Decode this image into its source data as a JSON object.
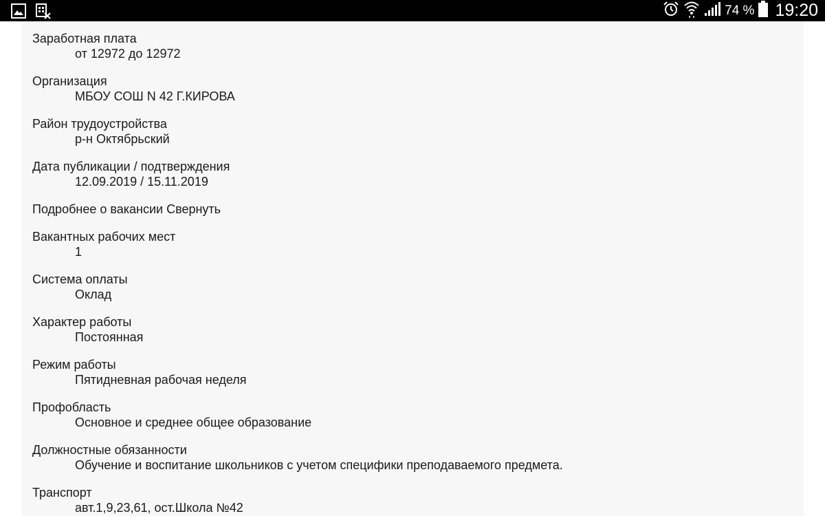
{
  "status_bar": {
    "left_icons": [
      "gallery-icon",
      "sim-toolkit-icon"
    ],
    "right_icons": [
      "alarm-icon",
      "wifi-icon",
      "signal-icon",
      "battery-icon"
    ],
    "battery": "74 %",
    "time": "19:20"
  },
  "vacancy": {
    "salary": {
      "label": "Заработная плата",
      "value": "от 12972 до 12972"
    },
    "organization": {
      "label": "Организация",
      "value": "МБОУ СОШ N 42 Г.КИРОВА"
    },
    "district": {
      "label": "Район трудоустройства",
      "value": "р-н Октябрьский"
    },
    "dates": {
      "label": "Дата публикации / подтверждения",
      "value": "12.09.2019 / 15.11.2019"
    },
    "details_toggle": {
      "label": "Подробнее о вакансии",
      "action": "Свернуть"
    },
    "vacant_places": {
      "label": "Вакантных рабочих мест",
      "value": "1"
    },
    "payment_system": {
      "label": "Система оплаты",
      "value": "Оклад"
    },
    "work_nature": {
      "label": "Характер работы",
      "value": "Постоянная"
    },
    "work_mode": {
      "label": "Режим работы",
      "value": "Пятидневная рабочая неделя"
    },
    "professional_area": {
      "label": "Профобласть",
      "value": "Основное и среднее общее образование"
    },
    "duties": {
      "label": "Должностные обязанности",
      "value": "Обучение и воспитание школьников с учетом специфики преподаваемого предмета."
    },
    "transport": {
      "label": "Транспорт",
      "value": "авт.1,9,23,61, ост.Школа №42"
    }
  }
}
